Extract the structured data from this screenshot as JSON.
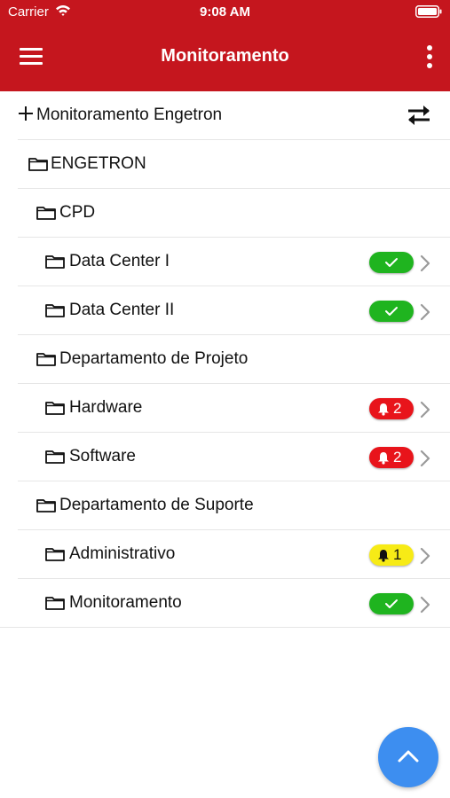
{
  "status_bar": {
    "carrier": "Carrier",
    "time": "9:08 AM",
    "wifi_icon": "wifi-icon",
    "battery_icon": "battery-icon"
  },
  "toolbar": {
    "title": "Monitoramento",
    "menu_icon": "hamburger-menu-icon",
    "more_icon": "more-vertical-icon",
    "background_color": "#c5161e"
  },
  "tree": {
    "root": {
      "label": "Monitoramento Engetron",
      "add_icon": "plus-icon",
      "swap_icon": "swap-arrows-icon"
    },
    "items": [
      {
        "label": "ENGETRON",
        "level": 0,
        "icon": "folder-icon",
        "status": null
      },
      {
        "label": "CPD",
        "level": 1,
        "icon": "folder-icon",
        "status": null
      },
      {
        "label": "Data Center I",
        "level": 2,
        "icon": "folder-icon",
        "status": {
          "type": "ok",
          "icon": "check-icon"
        }
      },
      {
        "label": "Data Center II",
        "level": 2,
        "icon": "folder-icon",
        "status": {
          "type": "ok",
          "icon": "check-icon"
        }
      },
      {
        "label": "Departamento de Projeto",
        "level": 1,
        "icon": "folder-icon",
        "status": null
      },
      {
        "label": "Hardware",
        "level": 2,
        "icon": "folder-icon",
        "status": {
          "type": "alarm",
          "icon": "bell-icon",
          "count": "2",
          "color": "#e8141b"
        }
      },
      {
        "label": "Software",
        "level": 2,
        "icon": "folder-icon",
        "status": {
          "type": "alarm",
          "icon": "bell-icon",
          "count": "2",
          "color": "#e8141b"
        }
      },
      {
        "label": "Departamento de Suporte",
        "level": 1,
        "icon": "folder-icon",
        "status": null
      },
      {
        "label": "Administrativo",
        "level": 2,
        "icon": "folder-icon",
        "status": {
          "type": "warning",
          "icon": "bell-icon",
          "count": "1",
          "color": "#f7eb16"
        }
      },
      {
        "label": "Monitoramento",
        "level": 2,
        "icon": "folder-icon",
        "status": {
          "type": "ok",
          "icon": "check-icon"
        }
      }
    ]
  },
  "colors": {
    "ok": "#1fb41f",
    "alarm": "#e8141b",
    "warning": "#f7eb16",
    "fab": "#3d8ef0"
  },
  "fab": {
    "icon": "chevron-up-icon"
  }
}
